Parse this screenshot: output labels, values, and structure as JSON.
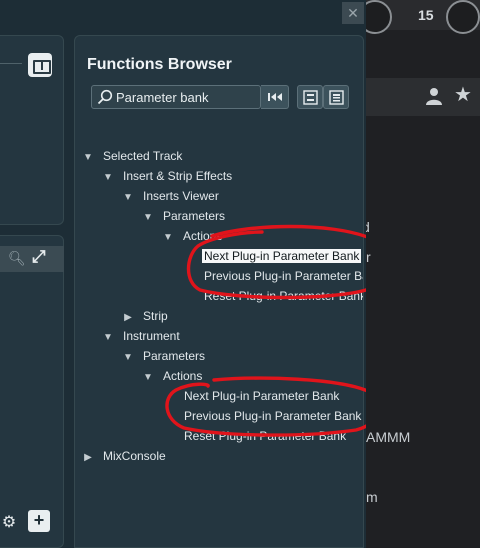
{
  "background": {
    "counter_value": "15",
    "text_fragments": [
      "d",
      "r",
      "AMMM",
      "m"
    ]
  },
  "dialog": {
    "close_label": "✕"
  },
  "functions_browser": {
    "title": "Functions Browser",
    "search": {
      "value": "Parameter bank",
      "placeholder": ""
    },
    "tree": [
      {
        "label": "Selected Track",
        "level": 0,
        "arrow": "down"
      },
      {
        "label": "Insert & Strip Effects",
        "level": 1,
        "arrow": "down"
      },
      {
        "label": "Inserts Viewer",
        "level": 2,
        "arrow": "down"
      },
      {
        "label": "Parameters",
        "level": 3,
        "arrow": "down"
      },
      {
        "label": "Actions",
        "level": 4,
        "arrow": "down"
      },
      {
        "label": "Next Plug-in Parameter Bank",
        "level": 5,
        "arrow": "none",
        "selected": true
      },
      {
        "label": "Previous Plug-in Parameter Bank",
        "level": 5,
        "arrow": "none"
      },
      {
        "label": "Reset Plug-in Parameter Bank",
        "level": 5,
        "arrow": "none"
      },
      {
        "label": "Strip",
        "level": 2,
        "arrow": "right"
      },
      {
        "label": "Instrument",
        "level": 1,
        "arrow": "down"
      },
      {
        "label": "Parameters",
        "level": 2,
        "arrow": "down"
      },
      {
        "label": "Actions",
        "level": 3,
        "arrow": "down"
      },
      {
        "label": "Next Plug-in Parameter Bank",
        "level": 4,
        "arrow": "none"
      },
      {
        "label": "Previous Plug-in Parameter Bank",
        "level": 4,
        "arrow": "none"
      },
      {
        "label": "Reset Plug-in Parameter Bank",
        "level": 4,
        "arrow": "none"
      },
      {
        "label": "MixConsole",
        "level": 0,
        "arrow": "right"
      }
    ]
  },
  "colors": {
    "panel_bg": "#243640",
    "selection_bg": "#f6f8f9",
    "annotation_red": "#e0141b"
  }
}
